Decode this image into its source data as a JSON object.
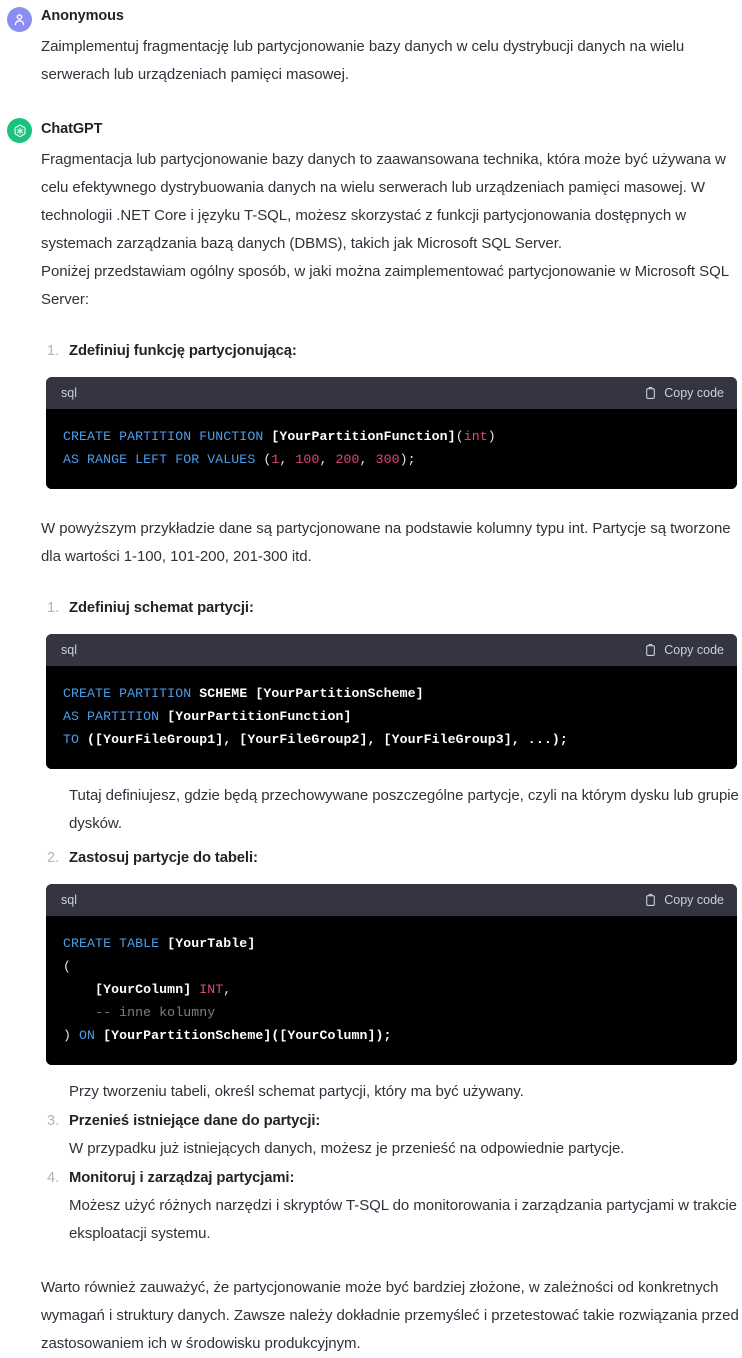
{
  "conversation": {
    "user_message": {
      "author": "Anonymous",
      "avatar_icon": "person-icon",
      "text": "Zaimplementuj fragmentację lub partycjonowanie bazy danych w celu dystrybucji danych na wielu serwerach lub urządzeniach pamięci masowej."
    },
    "assistant_message": {
      "author": "ChatGPT",
      "avatar_icon": "openai-logo-icon",
      "paragraph_1": "Fragmentacja lub partycjonowanie bazy danych to zaawansowana technika, która może być używana w celu efektywnego dystrybuowania danych na wielu serwerach lub urządzeniach pamięci masowej. W technologii .NET Core i języku T-SQL, możesz skorzystać z funkcji partycjonowania dostępnych w systemach zarządzania bazą danych (DBMS), takich jak Microsoft SQL Server.",
      "paragraph_2": "Poniżej przedstawiam ogólny sposób, w jaki można zaimplementować partycjonowanie w Microsoft SQL Server:",
      "step_1": {
        "marker": "1.",
        "title": "Zdefiniuj funkcję partycjonującą:"
      },
      "after_code_1": "W powyższym przykładzie dane są partycjonowane na podstawie kolumny typu int. Partycje są tworzone dla wartości 1-100, 101-200, 201-300 itd.",
      "step_2": {
        "marker": "1.",
        "title": "Zdefiniuj schemat partycji:"
      },
      "after_code_2": "Tutaj definiujesz, gdzie będą przechowywane poszczególne partycje, czyli na którym dysku lub grupie dysków.",
      "step_3": {
        "marker": "2.",
        "title": "Zastosuj partycje do tabeli:"
      },
      "after_code_3": "Przy tworzeniu tabeli, określ schemat partycji, który ma być używany.",
      "step_4": {
        "marker": "3.",
        "title": "Przenieś istniejące dane do partycji:",
        "body": "W przypadku już istniejących danych, możesz je przenieść na odpowiednie partycje."
      },
      "step_5": {
        "marker": "4.",
        "title": "Monitoruj i zarządzaj partycjami:",
        "body": "Możesz użyć różnych narzędzi i skryptów T-SQL do monitorowania i zarządzania partycjami w trakcie eksploatacji systemu."
      },
      "closing_paragraph": "Warto również zauważyć, że partycjonowanie może być bardziej złożone, w zależności od konkretnych wymagań i struktury danych. Zawsze należy dokładnie przemyśleć i przetestować takie rozwiązania przed zastosowaniem ich w środowisku produkcyjnym."
    }
  },
  "code_blocks": [
    {
      "language": "sql",
      "copy_label": "Copy code",
      "copy_icon": "clipboard-icon",
      "plain_text": "CREATE PARTITION FUNCTION [YourPartitionFunction](int)\nAS RANGE LEFT FOR VALUES (1, 100, 200, 300);"
    },
    {
      "language": "sql",
      "copy_label": "Copy code",
      "copy_icon": "clipboard-icon",
      "plain_text": "CREATE PARTITION SCHEME [YourPartitionScheme]\nAS PARTITION [YourPartitionFunction]\nTO ([YourFileGroup1], [YourFileGroup2], [YourFileGroup3], ...);"
    },
    {
      "language": "sql",
      "copy_label": "Copy code",
      "copy_icon": "clipboard-icon",
      "plain_text": "CREATE TABLE [YourTable]\n(\n    [YourColumn] INT,\n    -- inne kolumny\n) ON [YourPartitionScheme]([YourColumn]);"
    }
  ],
  "colors": {
    "page_background": "#ffffff",
    "text": "#2d333a",
    "heading": "#1f2328",
    "list_marker": "#aeb4bd",
    "code_header_bg": "#343541",
    "code_body_bg": "#000000",
    "code_keyword": "#4a9eea",
    "code_identifier": "#ffffff",
    "code_number": "#e2467d",
    "code_comment": "#7f7f7f",
    "avatar_user_bg": "#8b8ef0",
    "avatar_assistant_bg": "#19c37d"
  }
}
